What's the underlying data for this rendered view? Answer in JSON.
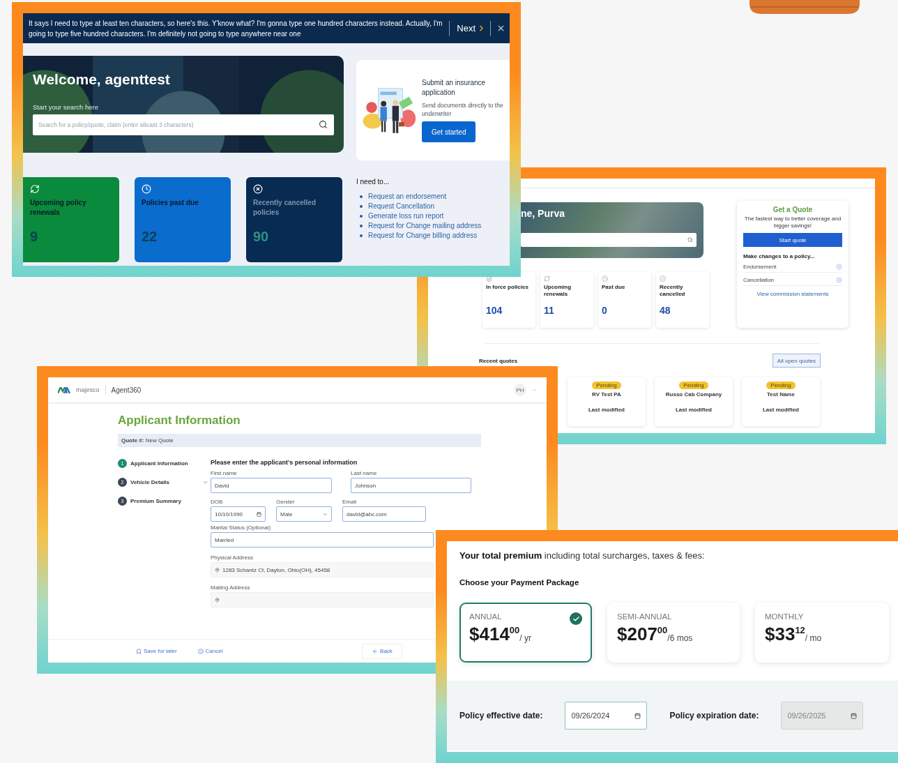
{
  "dashboard_screen": {
    "banner": {
      "message": "It says I need to type at least ten characters, so here's this. Y'know what? I'm gonna type one hundred characters instead. Actually, I'm going to type five hundred characters. I'm definitely not going to type anywhere near one",
      "next": "Next"
    },
    "welcome": "Welcome, agenttest",
    "search_label": "Start your search here",
    "search": {
      "placeholder": "Search for a policy/quote, claim (enter atleast 3 characters)"
    },
    "promo": {
      "title": "Submit an insurance application",
      "text": "Send documents directly to the underwriter",
      "button": "Get started"
    },
    "stats": [
      {
        "kind": "renewal",
        "label": "Upcoming policy renewals",
        "value": "9",
        "color": "#0a8a3c"
      },
      {
        "kind": "clock",
        "label": "Policies past due",
        "value": "22",
        "color": "#0a6ccc"
      },
      {
        "kind": "cancel",
        "label": "Recently cancelled policies",
        "value": "90",
        "color": "#072b52"
      }
    ],
    "tasks_title": "I need to...",
    "tasks": [
      "Request an endorsement",
      "Request Cancellation",
      "Generate loss run report",
      "Request for Change mailing address",
      "Request for Change billing address"
    ]
  },
  "agent_home_screen": {
    "welcome": "ne, Purva",
    "stats": [
      {
        "kind": "policy",
        "label": "In force policies",
        "value": "104"
      },
      {
        "kind": "renewal",
        "label": "Upcoming renewals",
        "value": "11"
      },
      {
        "kind": "clock",
        "label": "Past due",
        "value": "0"
      },
      {
        "kind": "cancel",
        "label": "Recently cancelled",
        "value": "48"
      }
    ],
    "quote_card": {
      "title": "Get a Quote",
      "text": "The fastest way to better coverage and bigger savings!",
      "button": "Start quote",
      "changes_title": "Make changes to a policy...",
      "changes": [
        "Endorsement",
        "Cancellation"
      ],
      "link": "View commission statements"
    },
    "recent_title": "Recent quotes",
    "all_button": "All open quotes",
    "quotes": [
      {
        "status": "Pending",
        "name": "RV Test PA",
        "footer": "Last modified"
      },
      {
        "status": "Pending",
        "name": "Russo Cab Company",
        "footer": "Last modified"
      },
      {
        "status": "Pending",
        "name": "Test Name",
        "footer": "Last modified"
      }
    ]
  },
  "applicant_screen": {
    "brand": "majesco",
    "product": "Agent360",
    "avatar": "PH",
    "title": "Applicant Information",
    "quote_line": "**Quote #:** New Quote",
    "steps": [
      {
        "number": "1",
        "label": "Applicant Information",
        "selected": true
      },
      {
        "number": "2",
        "label": "Vehicle Details",
        "selected": false,
        "expandable": true
      },
      {
        "number": "3",
        "label": "Premium Summary",
        "selected": false
      }
    ],
    "form_title": "Please enter the applicant's personal information",
    "fields": {
      "first_name": {
        "label": "First name",
        "value": "David"
      },
      "last_name": {
        "label": "Last name",
        "value": "Johnson"
      },
      "dob": {
        "label": "DOB",
        "value": "10/10/1990"
      },
      "gender": {
        "label": "Gender",
        "value": "Male"
      },
      "email": {
        "label": "Email",
        "value": "david@abc.com"
      },
      "marital": {
        "label": "Marital Status (Optional)",
        "value": "Married"
      },
      "physical": {
        "label": "Physical Address",
        "value": "1283 Schantz Ct, Dayton, Ohio(OH), 45458"
      },
      "mailing": {
        "label": "Mailing Address"
      }
    },
    "footer": {
      "save": "Save for later",
      "cancel": "Cancel",
      "back": "Back"
    }
  },
  "premium_screen": {
    "heading": "**Your total premium** including total surcharges, taxes & fees:",
    "subheading": "Choose your Payment Package",
    "plans": [
      {
        "label": "ANNUAL",
        "dollars": "$414",
        "cents": "00",
        "period": "/ yr",
        "selected": true
      },
      {
        "label": "SEMI-ANNUAL",
        "dollars": "$207",
        "cents": "00",
        "period": "/6 mos",
        "selected": false
      },
      {
        "label": "MONTHLY",
        "dollars": "$33",
        "cents": "12",
        "period": "/ mo",
        "selected": false
      }
    ],
    "dates": [
      {
        "label": "Policy effective date:",
        "value": "09/26/2024",
        "disabled": false
      },
      {
        "label": "Policy expiration date:",
        "value": "09/26/2025",
        "disabled": true
      }
    ]
  }
}
